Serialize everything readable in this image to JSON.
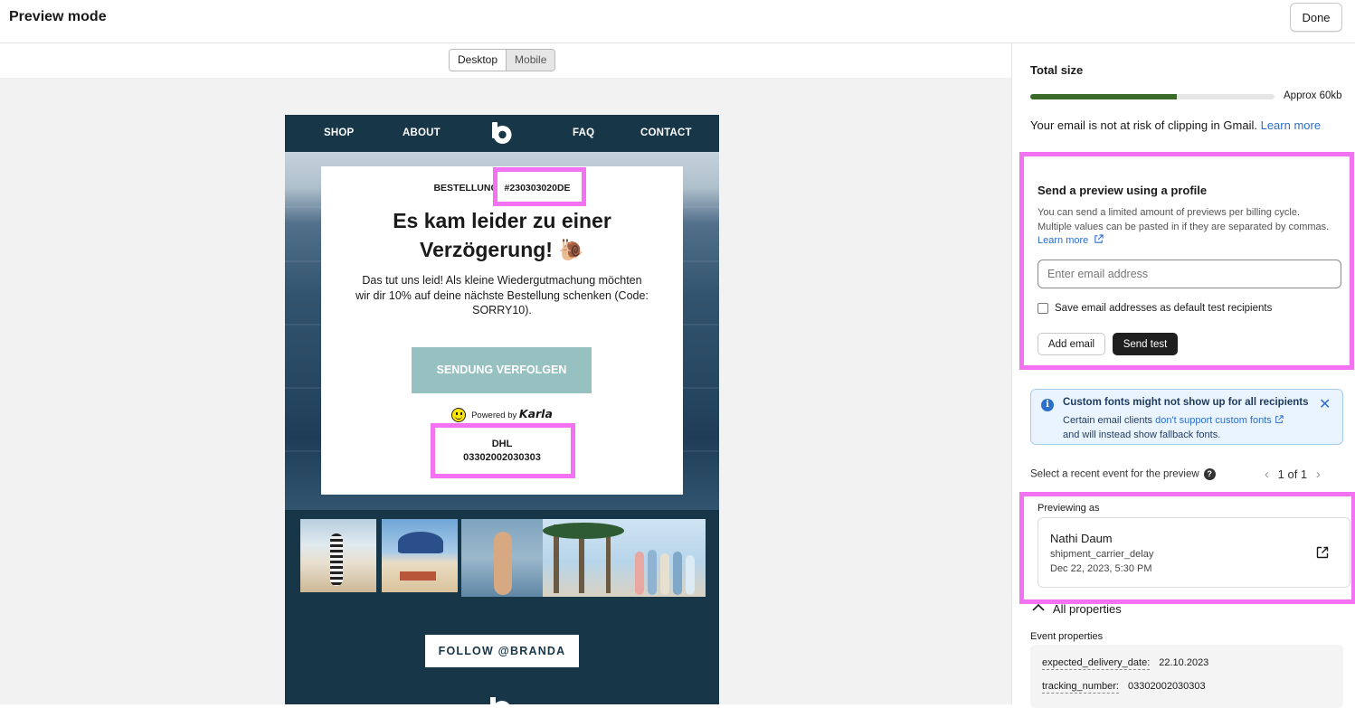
{
  "header": {
    "title": "Preview mode",
    "done_label": "Done"
  },
  "view_toggle": {
    "desktop": "Desktop",
    "mobile": "Mobile",
    "selected": "Desktop"
  },
  "email": {
    "nav": [
      "SHOP",
      "ABOUT",
      "FAQ",
      "CONTACT"
    ],
    "order_prefix": "BESTELLUNG",
    "order_number": "#230303020DE",
    "headline_line1": "Es kam leider zu einer",
    "headline_line2": "Verzögerung! 🐌",
    "body": "Das tut uns leid! Als kleine Wiedergutmachung möchten wir dir 10% auf deine nächste Bestellung schenken (Code: SORRY10).",
    "cta": "SENDUNG VERFOLGEN",
    "powered_by": "Powered by",
    "powered_brand": "Karla",
    "carrier": "DHL",
    "tracking": "03302002030303",
    "follow": "FOLLOW @BRANDA"
  },
  "size": {
    "label": "Total size",
    "fill_fraction": 0.6,
    "approx": "Approx 60kb",
    "clip_text": "Your email is not at risk of clipping in Gmail.",
    "learn_more": "Learn more"
  },
  "send_preview": {
    "title": "Send a preview using a profile",
    "desc_line1": "You can send a limited amount of previews per billing cycle.",
    "desc_line2": "Multiple values can be pasted in if they are separated by commas.",
    "learn_more": "Learn more",
    "input_placeholder": "Enter email address",
    "checkbox_label": "Save email addresses as default test recipients",
    "add_email": "Add email",
    "send_test": "Send test"
  },
  "banner": {
    "title": "Custom fonts might not show up for all recipients",
    "text_pre": "Certain email clients",
    "text_link": "don't support custom fonts",
    "text_post": "and will instead show fallback fonts."
  },
  "events": {
    "select_label": "Select a recent event for the preview",
    "pager": "1 of 1",
    "previewing_as": "Previewing as",
    "name": "Nathi Daum",
    "event": "shipment_carrier_delay",
    "date": "Dec 22, 2023, 5:30 PM",
    "all_properties": "All properties",
    "event_properties": "Event properties",
    "props": [
      {
        "key": "expected_delivery_date:",
        "value": "22.10.2023"
      },
      {
        "key": "tracking_number:",
        "value": "03302002030303"
      }
    ]
  },
  "colors": {
    "highlight": "#f272f2",
    "email_bg": "#173647",
    "cta": "#97c1c0",
    "link": "#2c6ecb"
  }
}
